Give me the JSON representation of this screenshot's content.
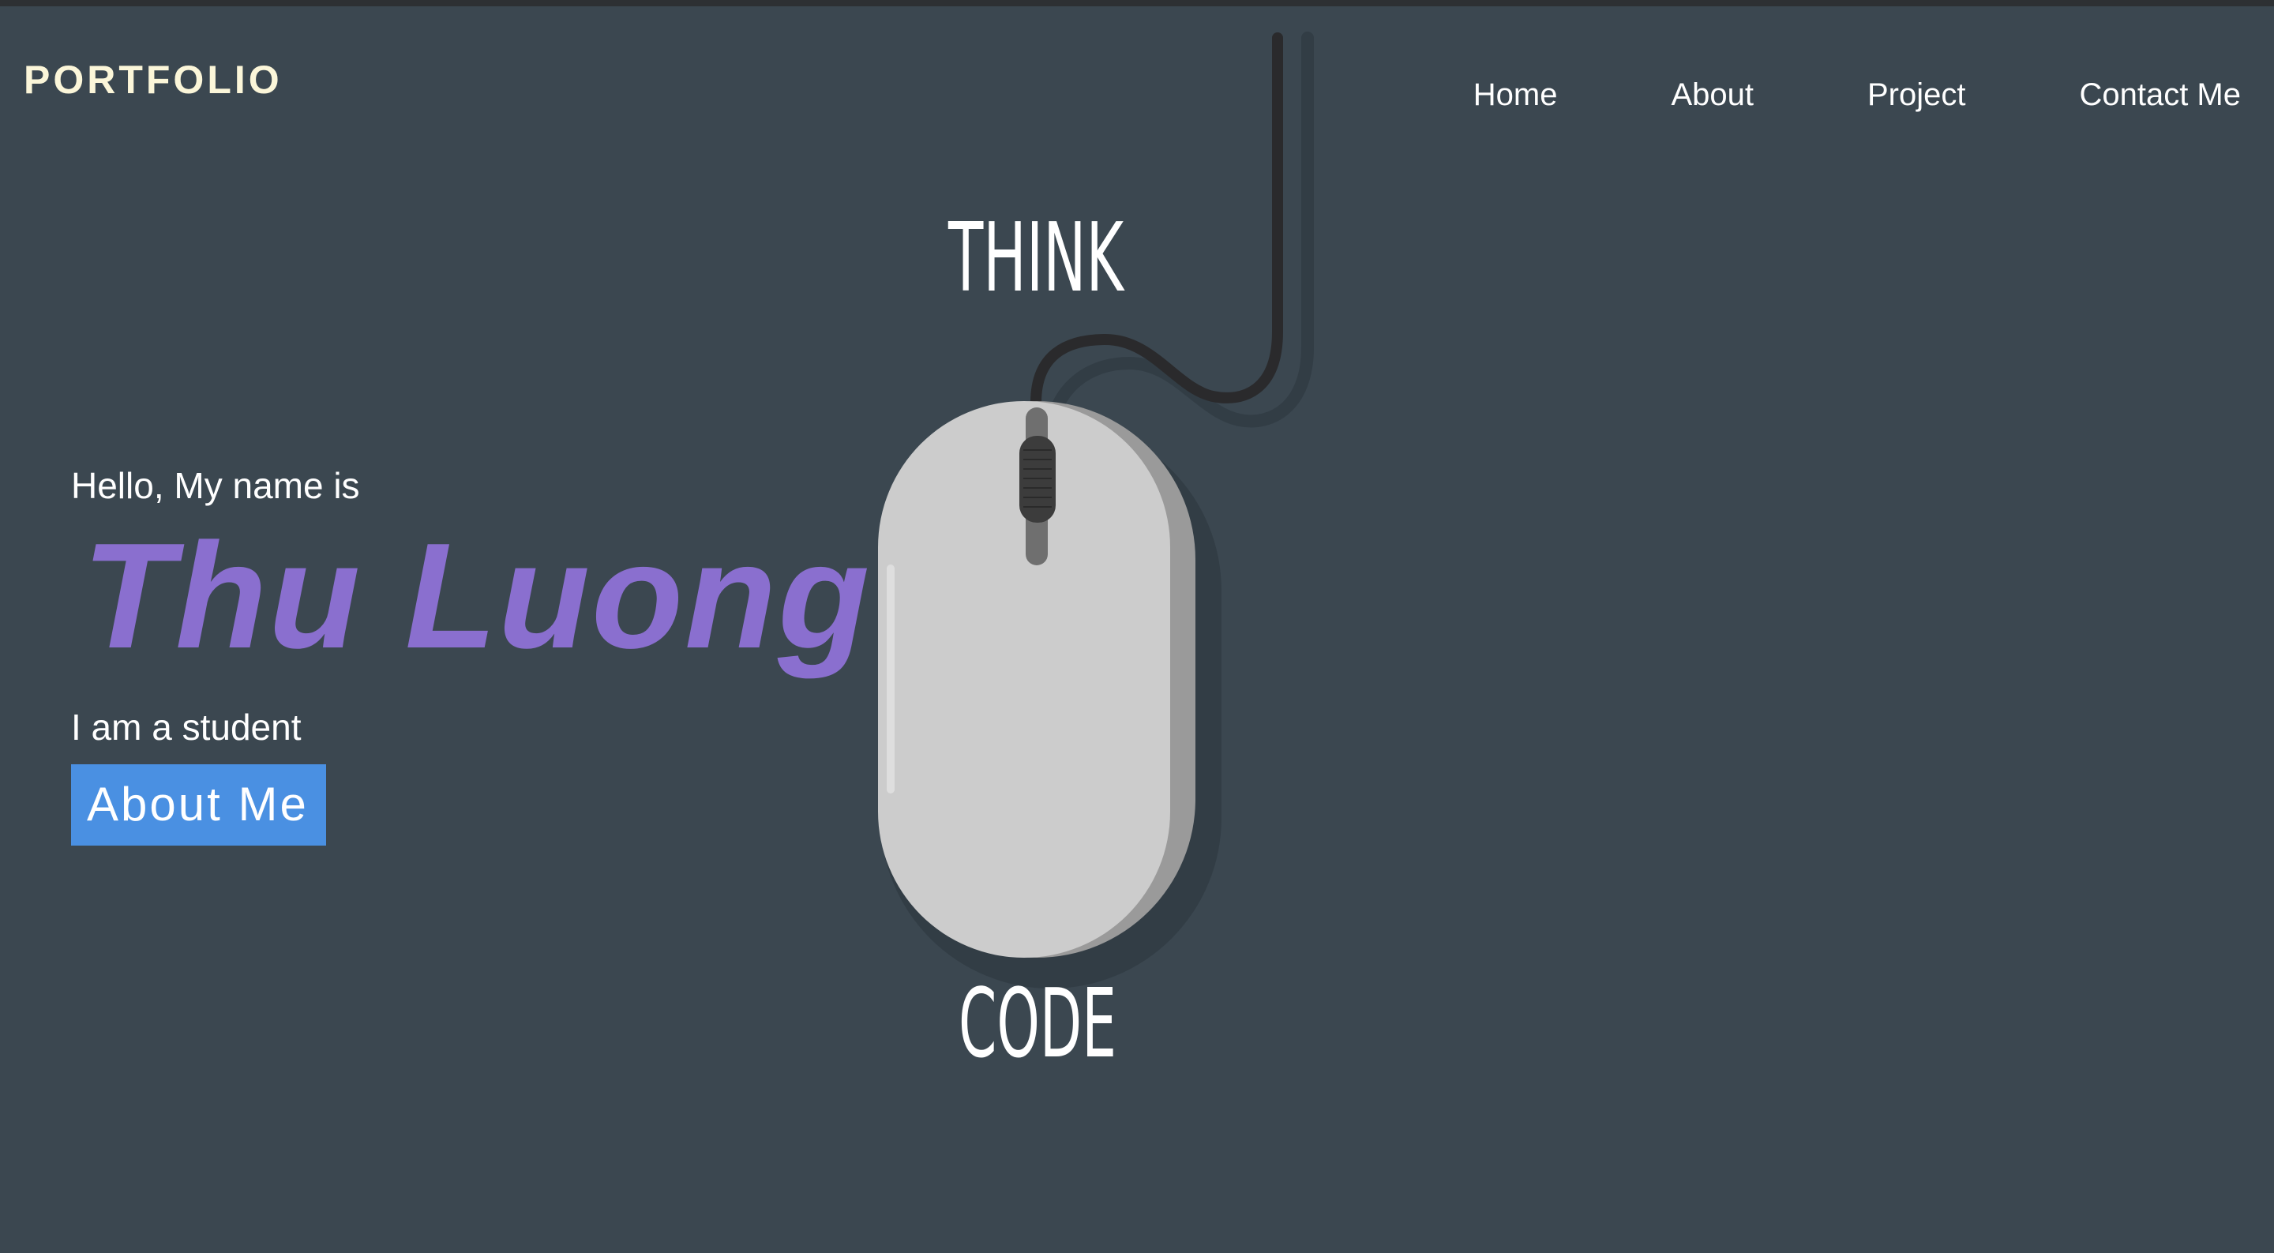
{
  "header": {
    "logo": "PORTFOLIO",
    "nav": [
      {
        "label": "Home"
      },
      {
        "label": "About"
      },
      {
        "label": "Project"
      },
      {
        "label": "Contact Me"
      }
    ]
  },
  "illustration": {
    "top_text": "THINK",
    "bottom_text": "CODE",
    "icon": "computer-mouse-icon"
  },
  "hero": {
    "greeting": "Hello, My name is",
    "name": "Thu Luong",
    "role": "I am a student",
    "button_label": "About Me"
  },
  "colors": {
    "background": "#3b4750",
    "logo": "#fbf6d9",
    "name_accent": "#8a6fcf",
    "button": "#4a90e2"
  }
}
